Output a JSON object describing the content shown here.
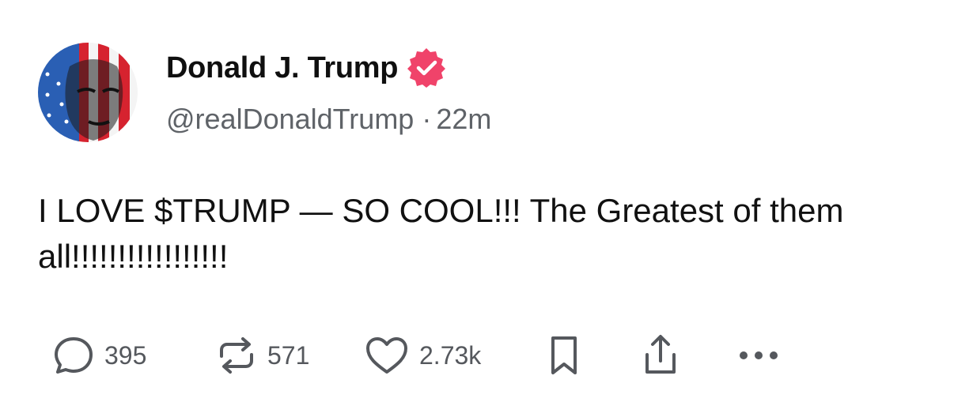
{
  "author": {
    "name": "Donald J. Trump",
    "handle": "@realDonaldTrump",
    "separator": "·",
    "time": "22m",
    "verified_color": "#f0436a"
  },
  "post": {
    "text": "I LOVE $TRUMP — SO COOL!!! The Greatest of them all!!!!!!!!!!!!!!!!!"
  },
  "actions": {
    "reply": {
      "icon": "comment-icon",
      "count": "395"
    },
    "repost": {
      "icon": "repost-icon",
      "count": "571"
    },
    "like": {
      "icon": "heart-icon",
      "count": "2.73k"
    },
    "bookmark": {
      "icon": "bookmark-icon"
    },
    "share": {
      "icon": "share-icon"
    },
    "more": {
      "icon": "more-icon"
    }
  },
  "colors": {
    "text": "#0f0f0f",
    "muted": "#5f6368",
    "icon": "#55585d",
    "flag_red": "#d6232f",
    "flag_blue": "#2a5fb4"
  }
}
